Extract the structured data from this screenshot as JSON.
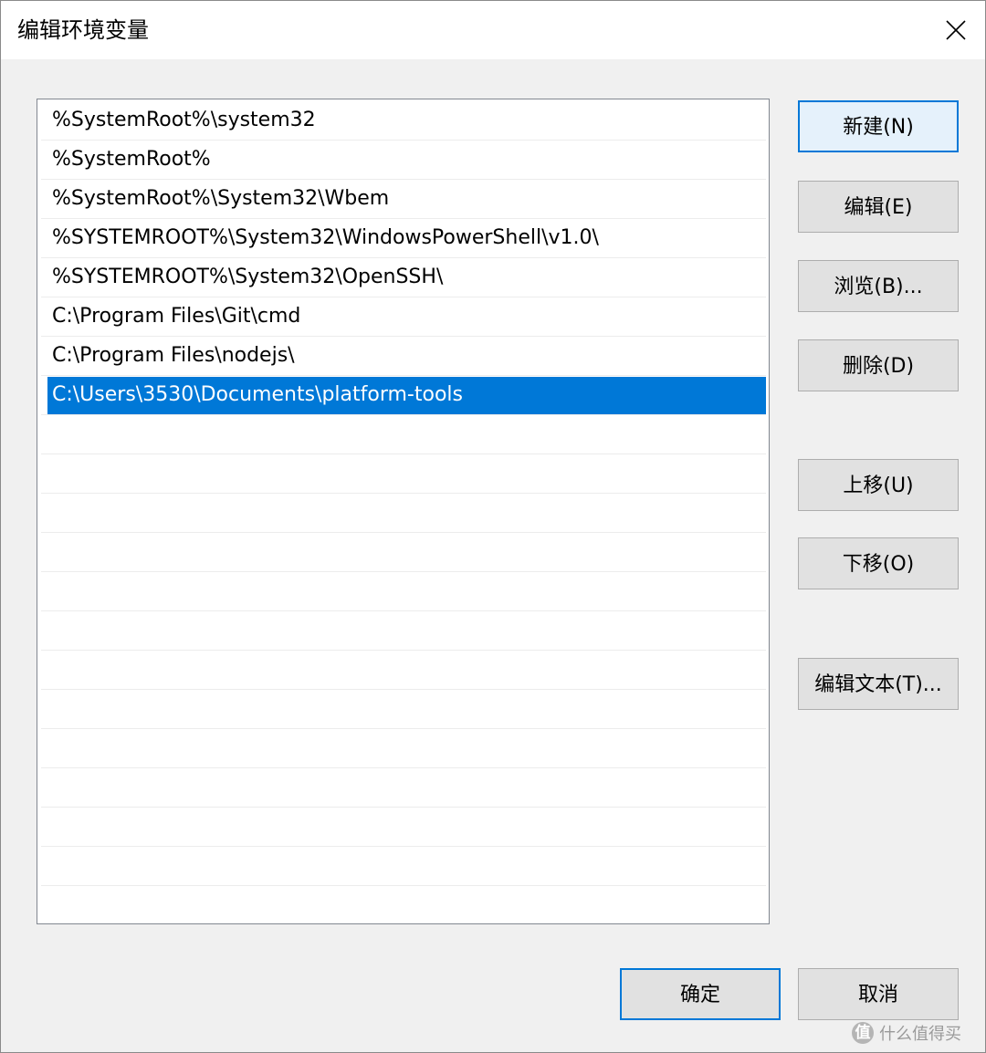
{
  "window": {
    "title": "编辑环境变量"
  },
  "path_list": {
    "items": [
      "%SystemRoot%\\system32",
      "%SystemRoot%",
      "%SystemRoot%\\System32\\Wbem",
      "%SYSTEMROOT%\\System32\\WindowsPowerShell\\v1.0\\",
      "%SYSTEMROOT%\\System32\\OpenSSH\\",
      "C:\\Program Files\\Git\\cmd",
      "C:\\Program Files\\nodejs\\",
      "C:\\Users\\3530\\Documents\\platform-tools"
    ],
    "selected_index": 7
  },
  "buttons": {
    "new": "新建(N)",
    "edit": "编辑(E)",
    "browse": "浏览(B)...",
    "delete": "删除(D)",
    "move_up": "上移(U)",
    "move_down": "下移(O)",
    "edit_text": "编辑文本(T)...",
    "ok": "确定",
    "cancel": "取消"
  },
  "watermark": {
    "badge": "值",
    "text": "什么值得买"
  },
  "colors": {
    "selection": "#0078d7",
    "focus_border": "#0078d7",
    "button_face": "#e1e1e1",
    "dialog_bg": "#f0f0f0"
  }
}
